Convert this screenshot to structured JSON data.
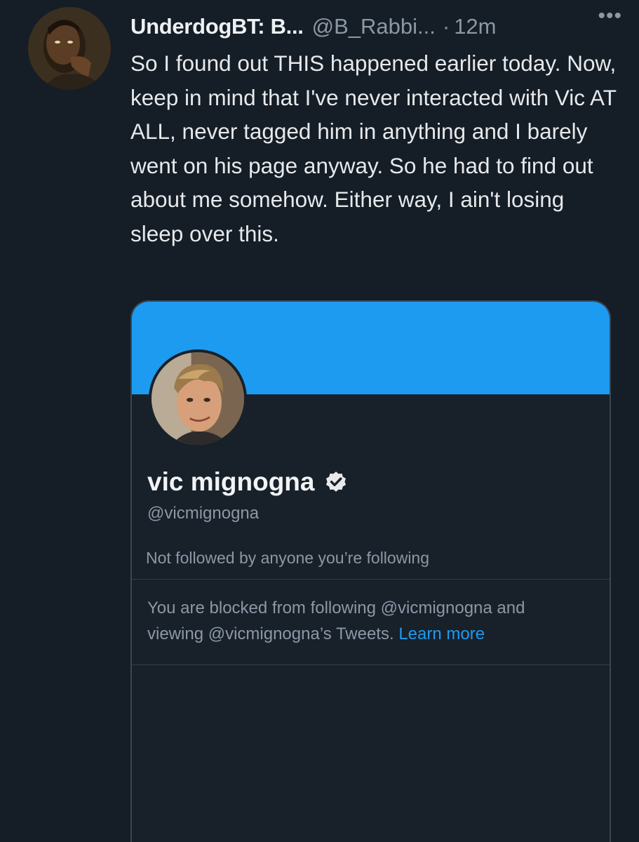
{
  "tweet": {
    "display_name": "UnderdogBT: B...",
    "handle": "@B_Rabbi...",
    "separator": "·",
    "time": "12m",
    "more_label": "•••",
    "text": "So I found out THIS happened earlier today. Now, keep in mind that I've never interacted with Vic AT ALL, never tagged him in anything and I barely went on his page anyway. So he had to find out about me somehow. Either way, I ain't losing sleep over this."
  },
  "profile_card": {
    "name": "vic mignogna",
    "handle": "@vicmignogna",
    "followed_by": "Not followed by anyone you’re following",
    "blocked_text": "You are blocked from following @vicmignogna and viewing @vicmignogna’s Tweets.",
    "learn_more": "Learn more",
    "banner_color": "#1d9bf0"
  },
  "icons": {
    "more": "more-horizontal-icon",
    "verified": "verified-badge-icon"
  },
  "colors": {
    "background": "#151d27",
    "accent": "#1d9bf0",
    "muted_text": "#8b98a5"
  }
}
